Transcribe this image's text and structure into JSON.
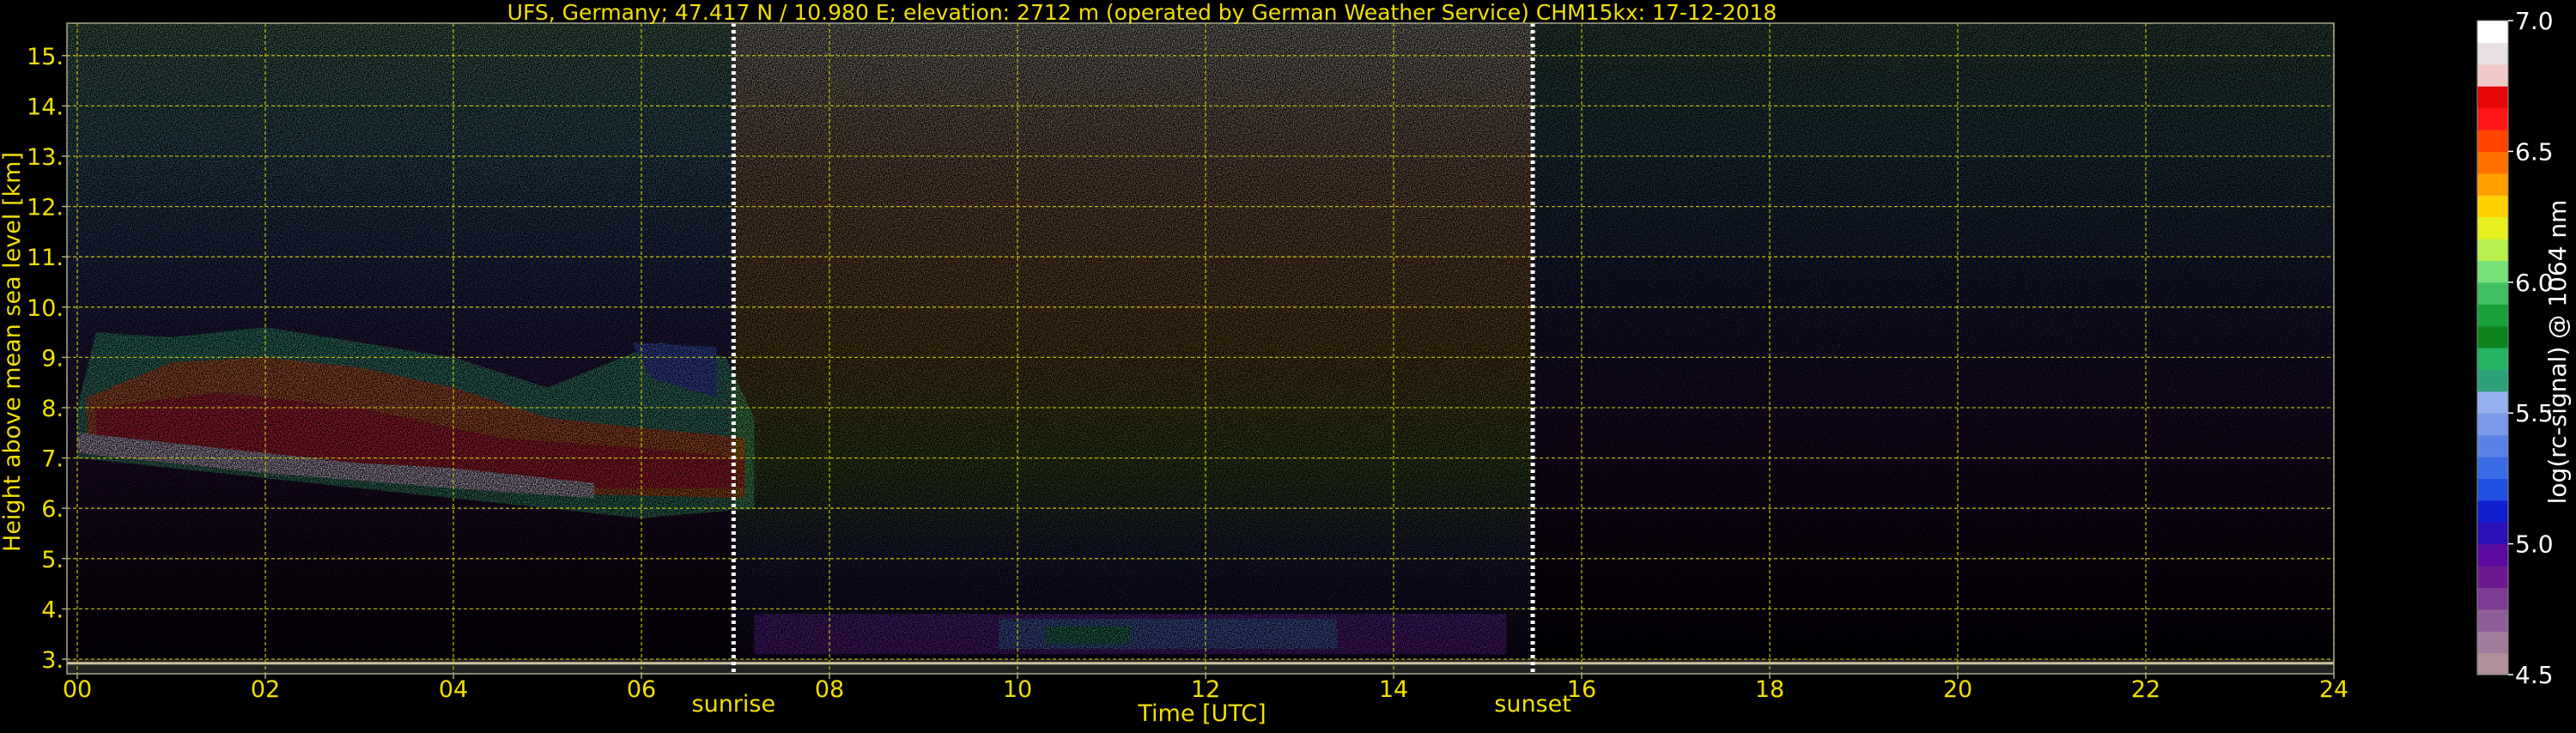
{
  "chart_data": {
    "type": "heatmap",
    "title": "UFS, Germany; 47.417 N / 10.980 E; elevation: 2712 m  (operated by German Weather Service)    CHM15kx: 17-12-2018",
    "xlabel": "Time [UTC]",
    "ylabel": "Height above mean sea level [km]",
    "xlim": [
      0,
      24
    ],
    "ylim": [
      2.8,
      15.7
    ],
    "x_ticks": [
      "00",
      "02",
      "04",
      "06",
      "08",
      "10",
      "12",
      "14",
      "16",
      "18",
      "20",
      "22",
      "24"
    ],
    "y_ticks": [
      "3.",
      "4.",
      "5.",
      "6.",
      "7.",
      "8.",
      "9.",
      "10.",
      "11.",
      "12.",
      "13.",
      "14.",
      "15."
    ],
    "grid": true,
    "colorbar": {
      "label": "log(rc-signal) @ 1064 nm",
      "range": [
        4.5,
        7.0
      ],
      "ticks": [
        "4.5",
        "5.0",
        "5.5",
        "6.0",
        "6.5",
        "7.0"
      ],
      "colors": [
        "#b09098",
        "#a07c9c",
        "#8e5e9a",
        "#7c3c92",
        "#6a1a8c",
        "#5a0aa0",
        "#2c10b8",
        "#1020d0",
        "#2050e0",
        "#3a6ae4",
        "#5a82e6",
        "#7a9ae8",
        "#96b0ee",
        "#2ea07a",
        "#24b464",
        "#10841e",
        "#1aa03a",
        "#40c060",
        "#78e078",
        "#b8f050",
        "#e6f020",
        "#ffd000",
        "#ffa000",
        "#ff7000",
        "#ff4400",
        "#ff1818",
        "#e60808",
        "#f0c8c8",
        "#e8e0e0",
        "#ffffff"
      ]
    },
    "annotations": [
      {
        "text": "sunrise",
        "x": 6.98
      },
      {
        "text": "sunset",
        "x": 15.48
      }
    ]
  }
}
